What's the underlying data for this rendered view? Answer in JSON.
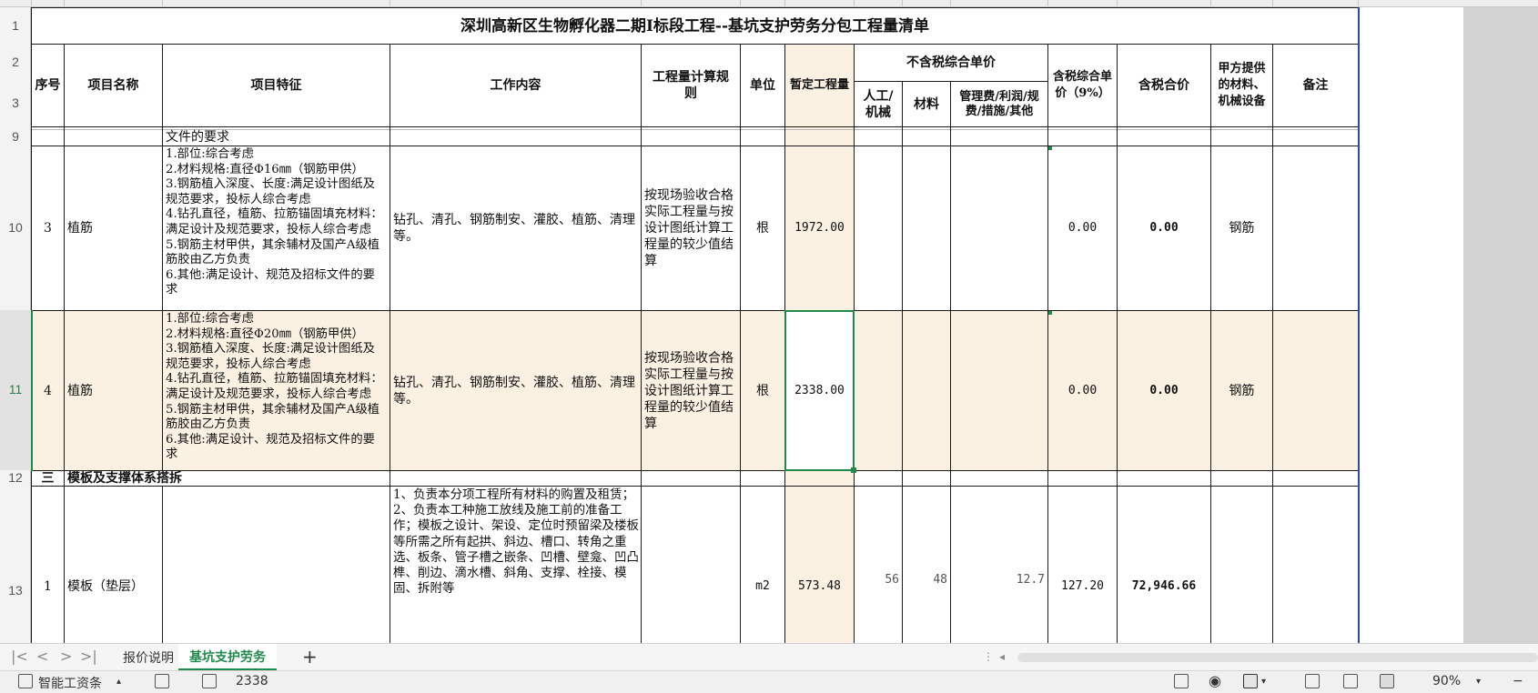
{
  "sheet": {
    "row_numbers": [
      "1",
      "2",
      "3",
      "9",
      "10",
      "11",
      "12",
      "13"
    ],
    "title": "深圳高新区生物孵化器二期Ⅰ标段工程--基坑支护劳务分包工程量清单",
    "headers": {
      "seq": "序号",
      "item_name": "项目名称",
      "item_features": "项目特征",
      "work_content": "工作内容",
      "calc_rule": "工程量计算规则",
      "unit": "单位",
      "provisional_qty": "暂定工程量",
      "unit_price_ex_tax": "不含税综合单价",
      "labor_machine": "人工/机械",
      "material": "材料",
      "mgmt_fee": "管理费/利润/规费/措施/其他",
      "tax_unit_price": "含税综合单价（9%）",
      "tax_total": "含税合价",
      "owner_supplied": "甲方提供的材料、机械设备",
      "remarks": "备注"
    },
    "row9_text": "文件的要求",
    "rows": [
      {
        "seq": "3",
        "name": "植筋",
        "features": "1.部位:综合考虑\n2.材料规格:直径Φ16㎜（钢筋甲供）\n3.钢筋植入深度、长度:满足设计图纸及规范要求，投标人综合考虑\n4.钻孔直径，植筋、拉筋锚固填充材料：满足设计及规范要求，投标人综合考虑\n5.钢筋主材甲供，其余辅材及国产A级植筋胶由乙方负责\n6.其他:满足设计、规范及招标文件的要求",
        "work": "钻孔、清孔、钢筋制安、灌胶、植筋、清理等。",
        "rule": "按现场验收合格实际工程量与按设计图纸计算工程量的较少值结算",
        "unit": "根",
        "qty": "1972.00",
        "tax_unit_price": "0.00",
        "tax_total": "0.00",
        "owner": "钢筋"
      },
      {
        "seq": "4",
        "name": "植筋",
        "features": "1.部位:综合考虑\n2.材料规格:直径Φ20㎜（钢筋甲供）\n3.钢筋植入深度、长度:满足设计图纸及规范要求，投标人综合考虑\n4.钻孔直径，植筋、拉筋锚固填充材料：满足设计及规范要求，投标人综合考虑\n5.钢筋主材甲供，其余辅材及国产A级植筋胶由乙方负责\n6.其他:满足设计、规范及招标文件的要求",
        "work": "钻孔、清孔、钢筋制安、灌胶、植筋、清理等。",
        "rule": "按现场验收合格实际工程量与按设计图纸计算工程量的较少值结算",
        "unit": "根",
        "qty": "2338.00",
        "tax_unit_price": "0.00",
        "tax_total": "0.00",
        "owner": "钢筋"
      }
    ],
    "section": {
      "seq": "三",
      "name": "模板及支撑体系搭拆"
    },
    "row13": {
      "seq": "1",
      "name": "模板（垫层）",
      "work": "1、负责本分项工程所有材料的购置及租赁；\n2、负责本工种施工放线及施工前的准备工作；模板之设计、架设、定位时预留梁及楼板等所需之所有起拱、斜边、槽口、转角之重选、板条、管子槽之嵌条、凹槽、壁龛、凹凸榫、削边、滴水槽、斜角、支撑、栓接、模固、拆附等",
      "unit": "m2",
      "qty": "573.48",
      "labor": "56",
      "material": "48",
      "mgmt": "12.7",
      "tax_unit_price": "127.20",
      "tax_total": "72,946.66"
    }
  },
  "tabs": {
    "items": [
      "报价说明",
      "基坑支护劳务"
    ],
    "active_index": 1,
    "add_label": "+"
  },
  "status": {
    "smart_tool": "智能工资条",
    "cell_value": "2338",
    "zoom": "90%"
  },
  "colors": {
    "selected_border": "#1f8a4c",
    "highlight_row": "#faf1e2",
    "active_tab": "#1f8a4c"
  }
}
